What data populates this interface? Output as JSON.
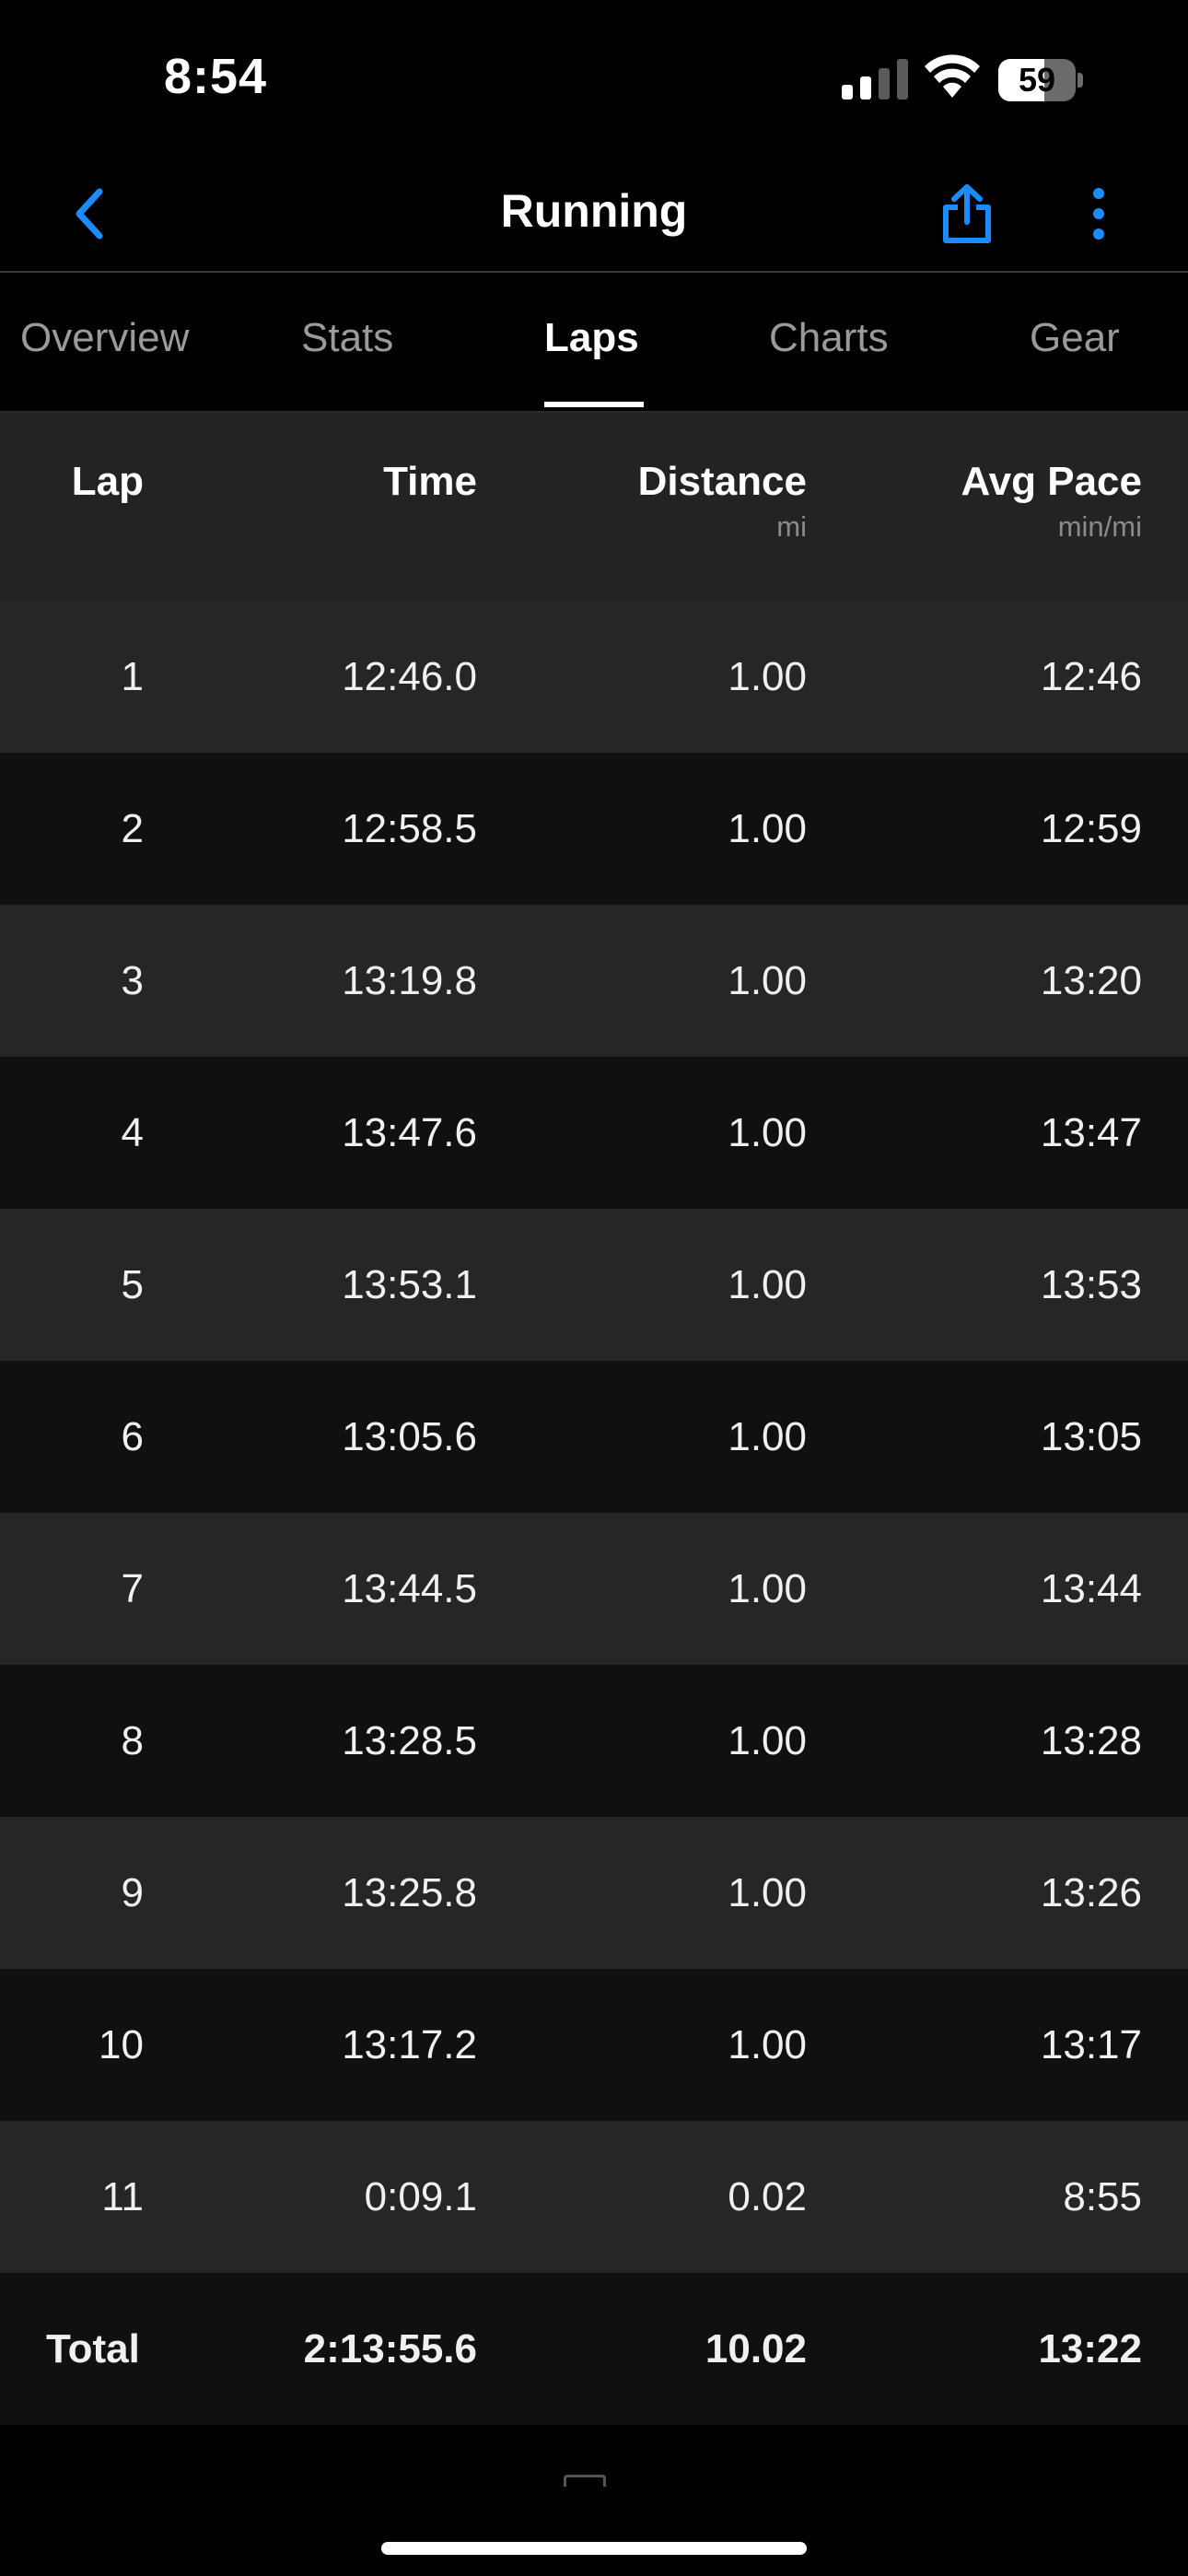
{
  "status_bar": {
    "time": "8:54",
    "battery": "59",
    "battery_level": 0.59
  },
  "nav": {
    "title": "Running",
    "back_icon": "chevron-left-icon",
    "share_icon": "share-icon",
    "more_icon": "vertical-ellipsis-icon",
    "accent_color": "#1a8cff"
  },
  "tabs": [
    {
      "label": "Overview",
      "active": false
    },
    {
      "label": "Stats",
      "active": false
    },
    {
      "label": "Laps",
      "active": true
    },
    {
      "label": "Charts",
      "active": false
    },
    {
      "label": "Gear",
      "active": false
    }
  ],
  "table": {
    "headers": {
      "lap": "Lap",
      "time": "Time",
      "distance": "Distance",
      "distance_unit": "mi",
      "pace": "Avg Pace",
      "pace_unit": "min/mi"
    },
    "rows": [
      {
        "lap": "1",
        "time": "12:46.0",
        "distance": "1.00",
        "pace": "12:46"
      },
      {
        "lap": "2",
        "time": "12:58.5",
        "distance": "1.00",
        "pace": "12:59"
      },
      {
        "lap": "3",
        "time": "13:19.8",
        "distance": "1.00",
        "pace": "13:20"
      },
      {
        "lap": "4",
        "time": "13:47.6",
        "distance": "1.00",
        "pace": "13:47"
      },
      {
        "lap": "5",
        "time": "13:53.1",
        "distance": "1.00",
        "pace": "13:53"
      },
      {
        "lap": "6",
        "time": "13:05.6",
        "distance": "1.00",
        "pace": "13:05"
      },
      {
        "lap": "7",
        "time": "13:44.5",
        "distance": "1.00",
        "pace": "13:44"
      },
      {
        "lap": "8",
        "time": "13:28.5",
        "distance": "1.00",
        "pace": "13:28"
      },
      {
        "lap": "9",
        "time": "13:25.8",
        "distance": "1.00",
        "pace": "13:26"
      },
      {
        "lap": "10",
        "time": "13:17.2",
        "distance": "1.00",
        "pace": "13:17"
      },
      {
        "lap": "11",
        "time": "0:09.1",
        "distance": "0.02",
        "pace": "8:55"
      }
    ],
    "total": {
      "lap": "Total",
      "time": "2:13:55.6",
      "distance": "10.02",
      "pace": "13:22"
    }
  }
}
